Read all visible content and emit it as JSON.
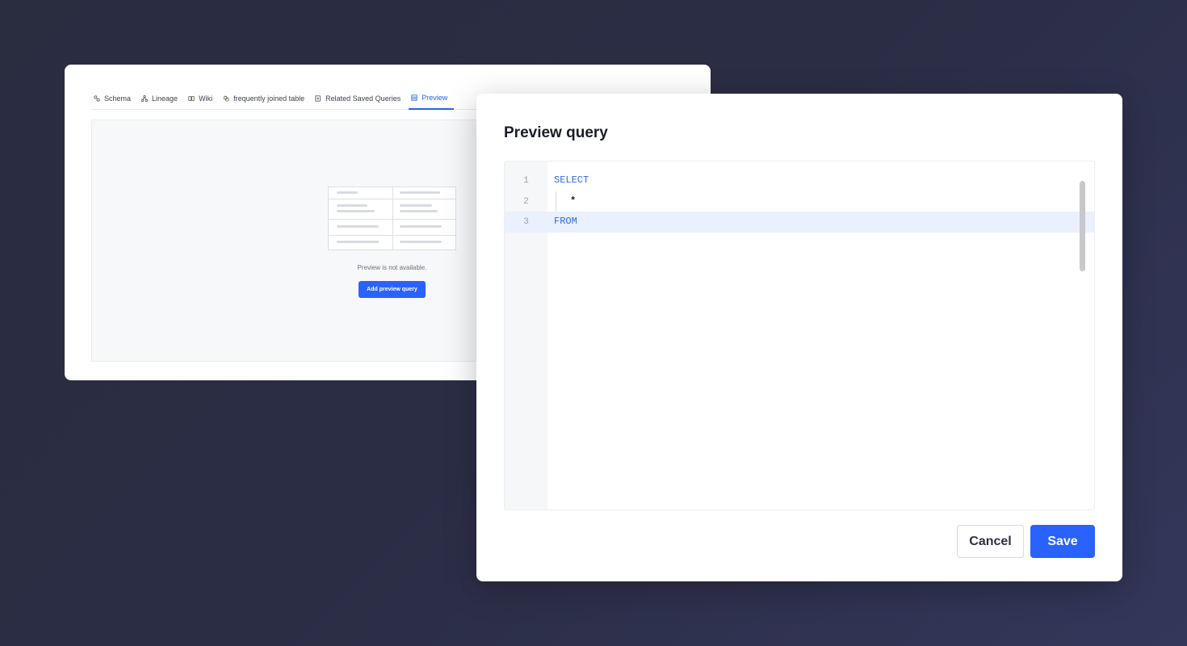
{
  "background_card": {
    "tabs": [
      {
        "label": "Schema",
        "icon": "schema-icon"
      },
      {
        "label": "Lineage",
        "icon": "lineage-icon"
      },
      {
        "label": "Wiki",
        "icon": "book-icon"
      },
      {
        "label": "frequently joined table",
        "icon": "join-icon"
      },
      {
        "label": "Related Saved Queries",
        "icon": "saved-query-icon"
      },
      {
        "label": "Preview",
        "icon": "table-icon",
        "active": true
      }
    ],
    "empty_state": {
      "message": "Preview is not available.",
      "button_label": "Add preview query"
    }
  },
  "modal": {
    "title": "Preview query",
    "editor": {
      "lines": [
        {
          "number": "1",
          "text": "SELECT"
        },
        {
          "number": "2",
          "text": "*"
        },
        {
          "number": "3",
          "text": "FROM"
        }
      ],
      "active_line": 3
    },
    "cancel_label": "Cancel",
    "save_label": "Save"
  },
  "colors": {
    "accent": "#2962ff",
    "keyword": "#2f6de1",
    "active_line_bg": "#eaf0fd"
  }
}
